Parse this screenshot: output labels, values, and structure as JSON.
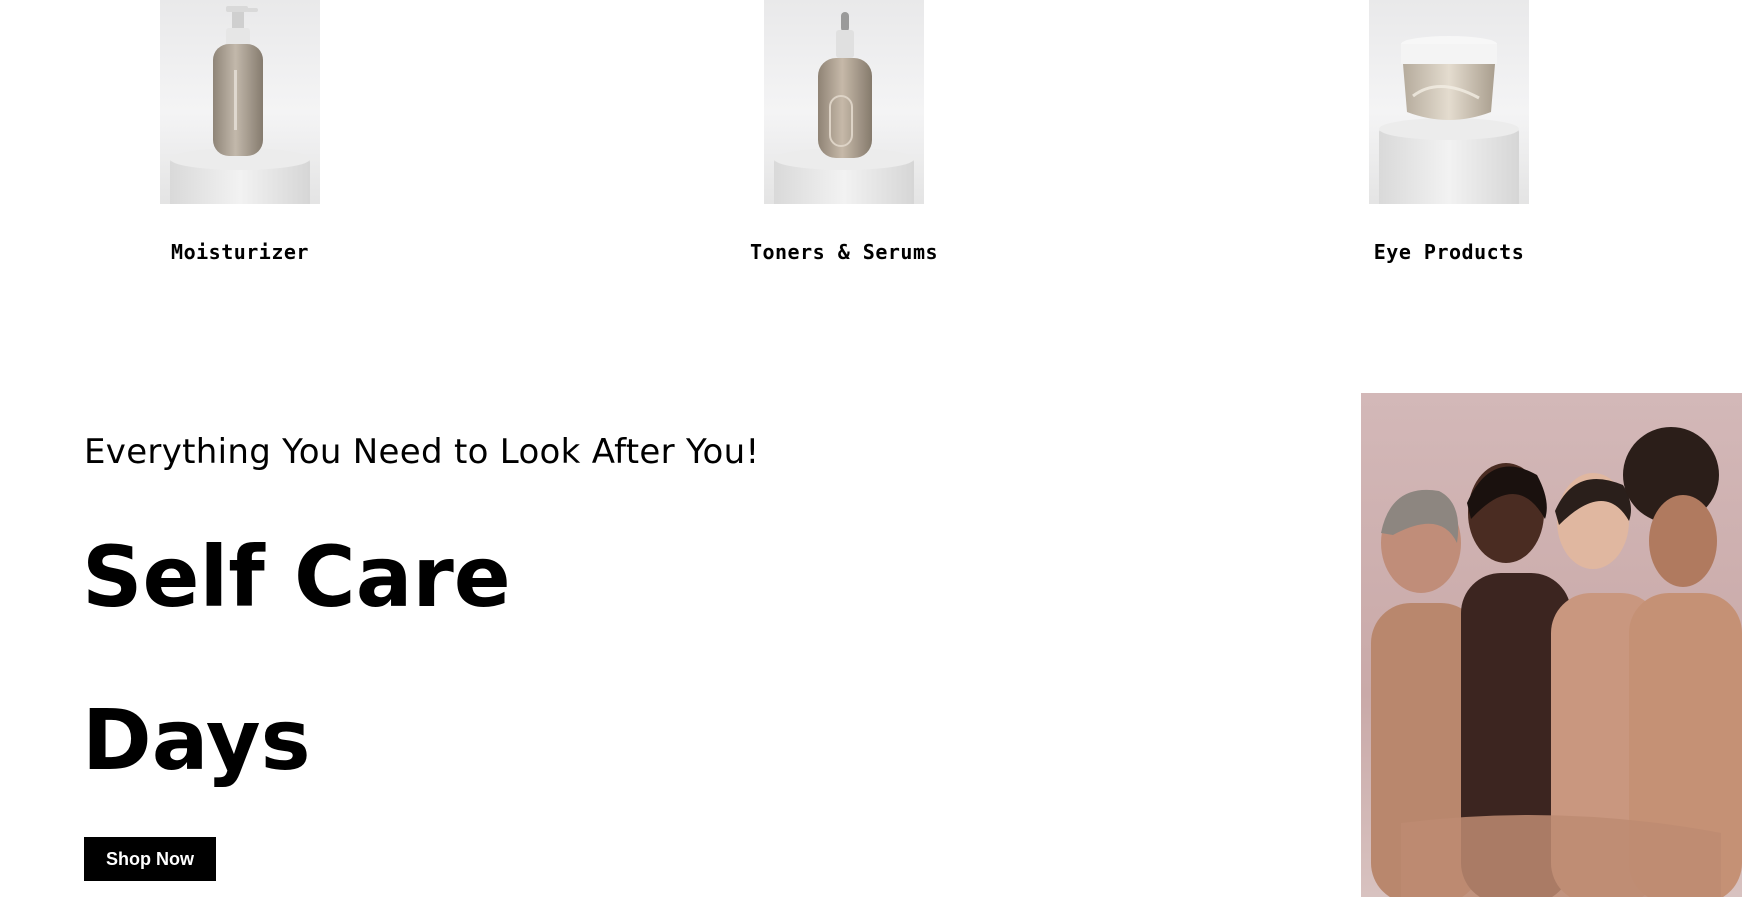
{
  "categories": [
    {
      "label": "Moisturizer",
      "icon": "pump-bottle-icon"
    },
    {
      "label": "Toners & Serums",
      "icon": "dropper-bottle-icon"
    },
    {
      "label": "Eye Products",
      "icon": "cream-jar-icon"
    }
  ],
  "hero": {
    "subtitle": "Everything You Need to Look After You!",
    "title_line1": "Self Care",
    "title_line2": "Days",
    "cta_label": "Shop Now"
  },
  "colors": {
    "button_bg": "#000000",
    "button_text": "#ffffff",
    "product_amber": "#a89c8e",
    "backdrop_pink": "#cdb0ae"
  }
}
